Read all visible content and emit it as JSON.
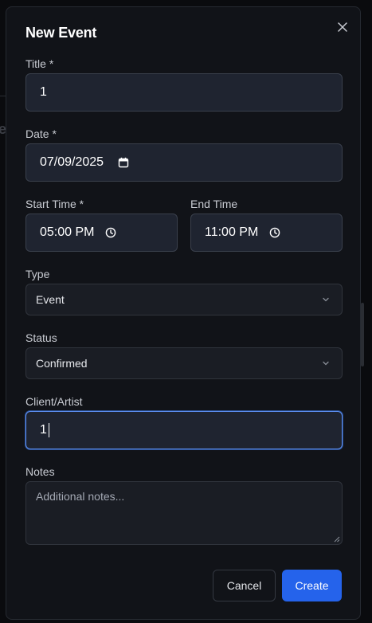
{
  "background": {
    "ghost_letter": "e"
  },
  "modal": {
    "title": "New Event",
    "close_icon": "close-icon",
    "fields": {
      "title": {
        "label": "Title *",
        "value": "1"
      },
      "date": {
        "label": "Date *",
        "value": "07/09/2025",
        "icon": "calendar-icon"
      },
      "start_time": {
        "label": "Start Time *",
        "value": "05:00 PM",
        "icon": "clock-icon"
      },
      "end_time": {
        "label": "End Time",
        "value": "11:00 PM",
        "icon": "clock-icon"
      },
      "type": {
        "label": "Type",
        "value": "Event",
        "icon": "chevron-down-icon"
      },
      "status": {
        "label": "Status",
        "value": "Confirmed",
        "icon": "chevron-down-icon"
      },
      "client_artist": {
        "label": "Client/Artist",
        "value": "1"
      },
      "notes": {
        "label": "Notes",
        "placeholder": "Additional notes..."
      }
    },
    "actions": {
      "cancel_label": "Cancel",
      "create_label": "Create"
    }
  },
  "colors": {
    "accent": "#2563eb",
    "focus_ring": "#5b8def",
    "modal_bg": "#111318",
    "input_bg": "#1f2430"
  }
}
